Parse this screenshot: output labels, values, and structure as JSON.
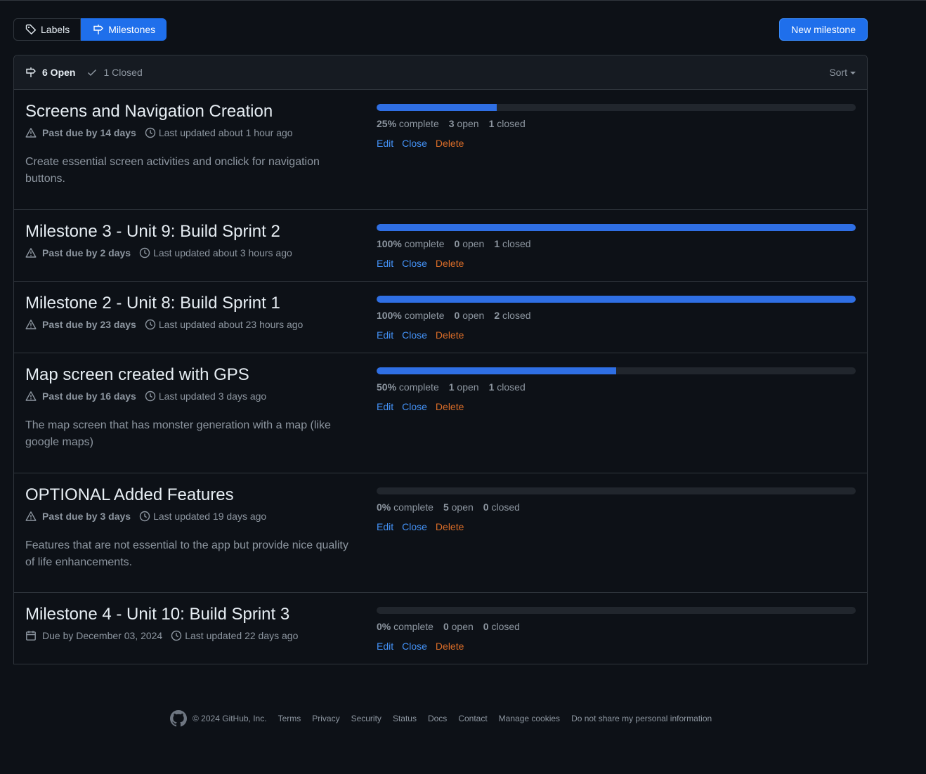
{
  "nav": {
    "labels_tab": "Labels",
    "milestones_tab": "Milestones",
    "new_milestone": "New milestone"
  },
  "header": {
    "open_label": "6 Open",
    "closed_label": "1 Closed",
    "sort_label": "Sort"
  },
  "milestones": [
    {
      "title": "Screens and Navigation Creation",
      "due_icon": "alert-icon",
      "due": "Past due by 14 days",
      "updated": "Last updated about 1 hour ago",
      "description": "Create essential screen activities and onclick for navigation buttons.",
      "progress": 0.25,
      "percent": "25%",
      "complete_word": "complete",
      "open_count": "3",
      "open_word": "open",
      "closed_count": "1",
      "closed_word": "closed",
      "edit": "Edit",
      "close": "Close",
      "delete": "Delete"
    },
    {
      "title": "Milestone 3 - Unit 9: Build Sprint 2",
      "due_icon": "alert-icon",
      "due": "Past due by 2 days",
      "updated": "Last updated about 3 hours ago",
      "description": "",
      "progress": 1.0,
      "percent": "100%",
      "complete_word": "complete",
      "open_count": "0",
      "open_word": "open",
      "closed_count": "1",
      "closed_word": "closed",
      "edit": "Edit",
      "close": "Close",
      "delete": "Delete"
    },
    {
      "title": "Milestone 2 - Unit 8: Build Sprint 1",
      "due_icon": "alert-icon",
      "due": "Past due by 23 days",
      "updated": "Last updated about 23 hours ago",
      "description": "",
      "progress": 1.0,
      "percent": "100%",
      "complete_word": "complete",
      "open_count": "0",
      "open_word": "open",
      "closed_count": "2",
      "closed_word": "closed",
      "edit": "Edit",
      "close": "Close",
      "delete": "Delete"
    },
    {
      "title": "Map screen created with GPS",
      "due_icon": "alert-icon",
      "due": "Past due by 16 days",
      "updated": "Last updated 3 days ago",
      "description": "The map screen that has monster generation with a map (like google maps)",
      "progress": 0.5,
      "percent": "50%",
      "complete_word": "complete",
      "open_count": "1",
      "open_word": "open",
      "closed_count": "1",
      "closed_word": "closed",
      "edit": "Edit",
      "close": "Close",
      "delete": "Delete"
    },
    {
      "title": "OPTIONAL Added Features",
      "due_icon": "alert-icon",
      "due": "Past due by 3 days",
      "updated": "Last updated 19 days ago",
      "description": "Features that are not essential to the app but provide nice quality of life enhancements.",
      "progress": 0.0,
      "percent": "0%",
      "complete_word": "complete",
      "open_count": "5",
      "open_word": "open",
      "closed_count": "0",
      "closed_word": "closed",
      "edit": "Edit",
      "close": "Close",
      "delete": "Delete"
    },
    {
      "title": "Milestone 4 - Unit 10: Build Sprint 3",
      "due_icon": "calendar-icon",
      "due": "Due by December 03, 2024",
      "updated": "Last updated 22 days ago",
      "description": "",
      "progress": 0.0,
      "percent": "0%",
      "complete_word": "complete",
      "open_count": "0",
      "open_word": "open",
      "closed_count": "0",
      "closed_word": "closed",
      "edit": "Edit",
      "close": "Close",
      "delete": "Delete"
    }
  ],
  "footer": {
    "copyright": "© 2024 GitHub, Inc.",
    "links": [
      "Terms",
      "Privacy",
      "Security",
      "Status",
      "Docs",
      "Contact",
      "Manage cookies",
      "Do not share my personal information"
    ]
  },
  "colors": {
    "accent": "#1f6feb",
    "progress": "#2f6fe4",
    "link": "#4493f8",
    "danger": "#db6d28",
    "bg": "#0d1117"
  }
}
